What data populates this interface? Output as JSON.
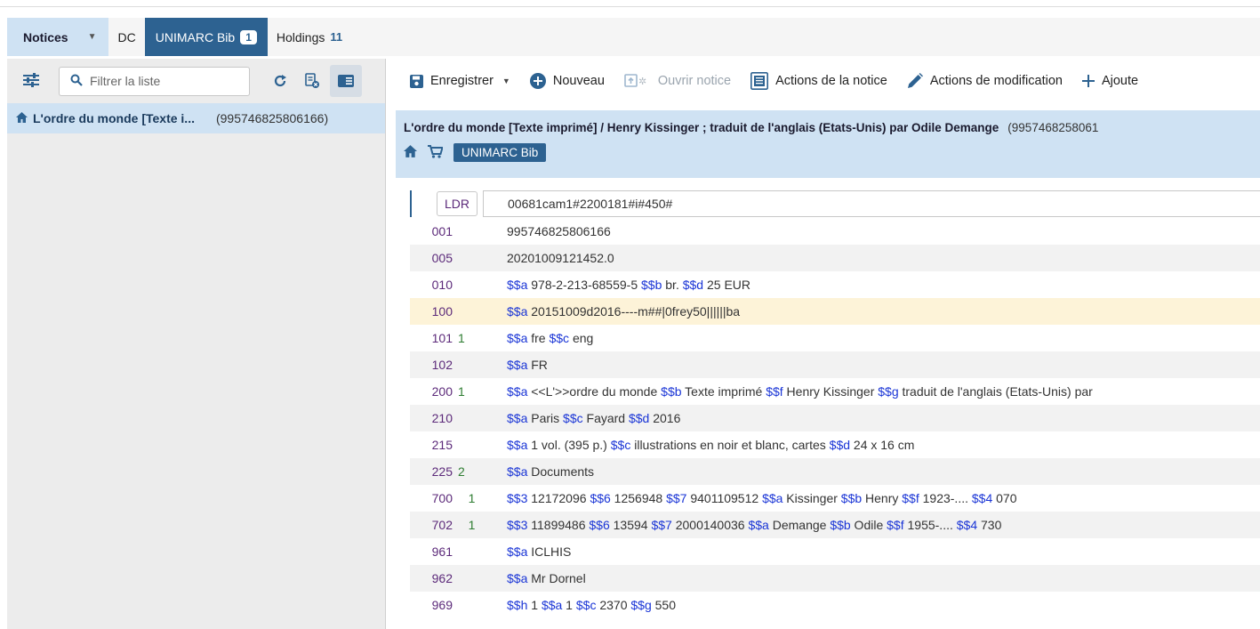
{
  "tabs": {
    "notices_label": "Notices",
    "dc_label": "DC",
    "unimarc_label": "UNIMARC Bib",
    "unimarc_badge": "1",
    "holdings_label": "Holdings",
    "holdings_count": "11"
  },
  "left": {
    "filter_placeholder": "Filtrer la liste",
    "item_title": "L'ordre du monde [Texte i...",
    "item_mms": "(995746825806166)"
  },
  "toolbar": {
    "save": "Enregistrer",
    "new": "Nouveau",
    "open": "Ouvrir notice",
    "record_actions": "Actions de la notice",
    "edit_actions": "Actions de modification",
    "add": "Ajoute"
  },
  "record": {
    "title": "L'ordre du monde [Texte imprimé] / Henry Kissinger ; traduit de l'anglais (Etats-Unis) par Odile Demange",
    "mms": "(9957468258061",
    "chip": "UNIMARC Bib"
  },
  "ldr": {
    "tag": "LDR",
    "value": "00681cam1#2200181#i#450#"
  },
  "fields": [
    {
      "tag": "001",
      "ind": "",
      "parts": [
        {
          "t": "995746825806166"
        }
      ]
    },
    {
      "tag": "005",
      "ind": "",
      "parts": [
        {
          "t": "20201009121452.0"
        }
      ]
    },
    {
      "tag": "010",
      "ind": "",
      "parts": [
        {
          "sf": "$$a"
        },
        {
          "t": " 978-2-213-68559-5 "
        },
        {
          "sf": "$$b"
        },
        {
          "t": " br. "
        },
        {
          "sf": "$$d"
        },
        {
          "t": " 25 EUR"
        }
      ]
    },
    {
      "tag": "100",
      "ind": "",
      "parts": [
        {
          "sf": "$$a"
        },
        {
          "t": " 20151009d2016----m##|0frey50||||||ba"
        }
      ]
    },
    {
      "tag": "101",
      "ind": "1",
      "parts": [
        {
          "sf": "$$a"
        },
        {
          "t": " fre "
        },
        {
          "sf": "$$c"
        },
        {
          "t": " eng"
        }
      ]
    },
    {
      "tag": "102",
      "ind": "",
      "parts": [
        {
          "sf": "$$a"
        },
        {
          "t": " FR"
        }
      ]
    },
    {
      "tag": "200",
      "ind": "1",
      "parts": [
        {
          "sf": "$$a"
        },
        {
          "t": " <<L'>>ordre du monde "
        },
        {
          "sf": "$$b"
        },
        {
          "t": " Texte imprimé "
        },
        {
          "sf": "$$f"
        },
        {
          "t": " Henry Kissinger "
        },
        {
          "sf": "$$g"
        },
        {
          "t": " traduit de l'anglais (Etats-Unis) par"
        }
      ]
    },
    {
      "tag": "210",
      "ind": "",
      "parts": [
        {
          "sf": "$$a"
        },
        {
          "t": " Paris "
        },
        {
          "sf": "$$c"
        },
        {
          "t": " Fayard "
        },
        {
          "sf": "$$d"
        },
        {
          "t": " 2016"
        }
      ]
    },
    {
      "tag": "215",
      "ind": "",
      "parts": [
        {
          "sf": "$$a"
        },
        {
          "t": " 1 vol. (395 p.) "
        },
        {
          "sf": "$$c"
        },
        {
          "t": " illustrations en noir et blanc, cartes "
        },
        {
          "sf": "$$d"
        },
        {
          "t": " 24 x 16 cm"
        }
      ]
    },
    {
      "tag": "225",
      "ind": "2",
      "parts": [
        {
          "sf": "$$a"
        },
        {
          "t": " Documents"
        }
      ]
    },
    {
      "tag": "700",
      "ind": "   1",
      "parts": [
        {
          "sf": "$$3"
        },
        {
          "t": " 12172096 "
        },
        {
          "sf": "$$6"
        },
        {
          "t": " 1256948 "
        },
        {
          "sf": "$$7"
        },
        {
          "t": " 9401109512 "
        },
        {
          "sf": "$$a"
        },
        {
          "t": " Kissinger "
        },
        {
          "sf": "$$b"
        },
        {
          "t": " Henry "
        },
        {
          "sf": "$$f"
        },
        {
          "t": " 1923-.... "
        },
        {
          "sf": "$$4"
        },
        {
          "t": " 070"
        }
      ]
    },
    {
      "tag": "702",
      "ind": "   1",
      "parts": [
        {
          "sf": "$$3"
        },
        {
          "t": " 11899486 "
        },
        {
          "sf": "$$6"
        },
        {
          "t": " 13594 "
        },
        {
          "sf": "$$7"
        },
        {
          "t": " 2000140036 "
        },
        {
          "sf": "$$a"
        },
        {
          "t": " Demange "
        },
        {
          "sf": "$$b"
        },
        {
          "t": " Odile "
        },
        {
          "sf": "$$f"
        },
        {
          "t": " 1955-.... "
        },
        {
          "sf": "$$4"
        },
        {
          "t": " 730"
        }
      ]
    },
    {
      "tag": "961",
      "ind": "",
      "parts": [
        {
          "sf": "$$a"
        },
        {
          "t": " ICLHIS"
        }
      ]
    },
    {
      "tag": "962",
      "ind": "",
      "parts": [
        {
          "sf": "$$a"
        },
        {
          "t": " Mr Dornel"
        }
      ]
    },
    {
      "tag": "969",
      "ind": "",
      "parts": [
        {
          "sf": "$$h"
        },
        {
          "t": " 1 "
        },
        {
          "sf": "$$a"
        },
        {
          "t": " 1 "
        },
        {
          "sf": "$$c"
        },
        {
          "t": " 2370 "
        },
        {
          "sf": "$$g"
        },
        {
          "t": " 550"
        }
      ]
    }
  ],
  "colors": {
    "accent": "#2d6291",
    "highlight": "#cfe2f3",
    "subfield": "#1a35d6",
    "tag": "#5c2a7a"
  }
}
